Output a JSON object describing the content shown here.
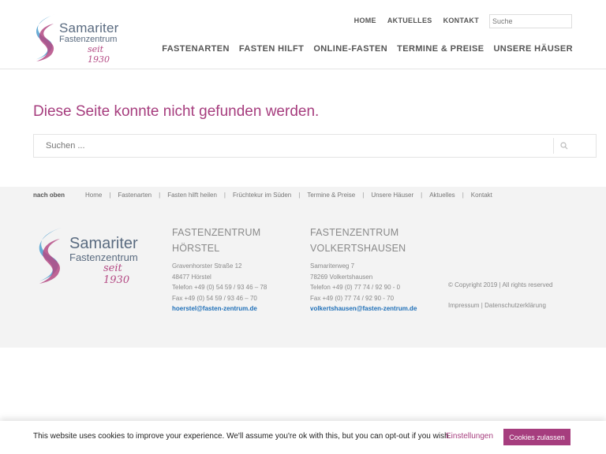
{
  "colors": {
    "accent": "#a63d7e",
    "logo_blue": "#5a6b80",
    "footer_bg": "#f3f3f3",
    "link": "#1e6fb8"
  },
  "brand": {
    "name": "Samariter",
    "subtitle": "Fastenzentrum",
    "since": "seit 1930"
  },
  "topnav": [
    "HOME",
    "AKTUELLES",
    "KONTAKT"
  ],
  "header_search": {
    "placeholder": "Suche"
  },
  "mainnav": [
    "FASTENARTEN",
    "FASTEN HILFT",
    "ONLINE-FASTEN",
    "TERMINE & PREISE",
    "UNSERE HÄUSER"
  ],
  "page": {
    "title": "Diese Seite konnte nicht gefunden werden.",
    "search_placeholder": "Suchen ..."
  },
  "footer": {
    "back_to_top": "nach oben",
    "nav": [
      "Home",
      "Fastenarten",
      "Fasten hilft heilen",
      "Früchtekur im Süden",
      "Termine & Preise",
      "Unsere Häuser",
      "Aktuelles",
      "Kontakt"
    ],
    "centers": [
      {
        "title_line1": "FASTENZENTRUM",
        "title_line2": "HÖRSTEL",
        "street": "Gravenhorster Straße 12",
        "city": "48477 Hörstel",
        "phone": "Telefon +49 (0) 54 59 / 93 46 – 78",
        "fax": "Fax +49 (0) 54 59 / 93 46 – 70",
        "email": "hoerstel@fasten-zentrum.de"
      },
      {
        "title_line1": "FASTENZENTRUM",
        "title_line2": "VOLKERTSHAUSEN",
        "street": "Samariterweg 7",
        "city": "78269 Volkertshausen",
        "phone": "Telefon +49 (0) 77 74 / 92 90 - 0",
        "fax": "Fax +49 (0) 77 74 / 92 90 - 70",
        "email": "volkertshausen@fasten-zentrum.de"
      }
    ],
    "copyright": "© Copyright 2019 | All rights reserved",
    "impressum": "Impressum",
    "legal_sep": "|",
    "datenschutz": "Datenschutzerklärung"
  },
  "cookie": {
    "text": "This website uses cookies to improve your experience. We'll assume you're ok with this, but you can opt-out if you wish.",
    "settings": "Einstellungen",
    "accept": "Cookies zulassen"
  }
}
